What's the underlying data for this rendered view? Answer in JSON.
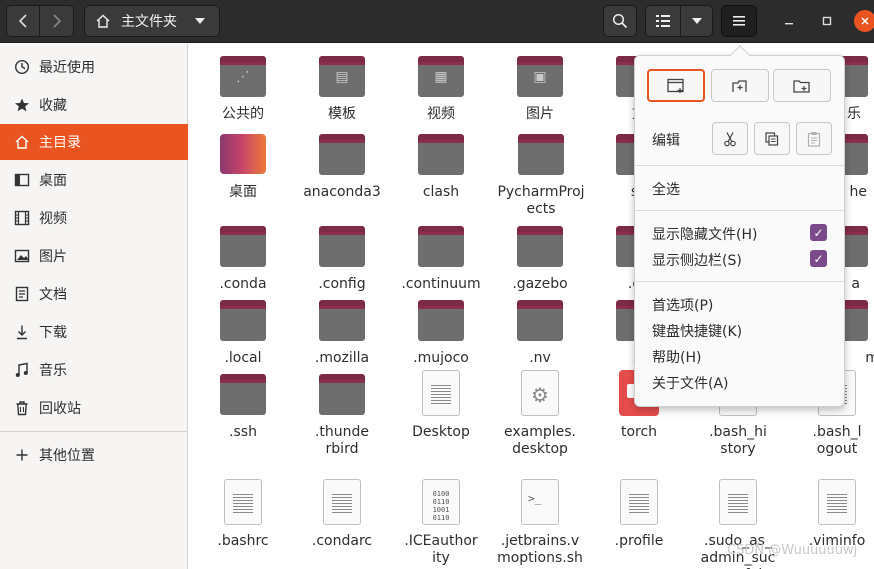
{
  "header": {
    "path_label": "主文件夹",
    "back_icon": "chevron-left-icon",
    "forward_icon": "chevron-right-icon"
  },
  "sidebar": {
    "items": [
      {
        "label": "最近使用",
        "icon": "clock-icon"
      },
      {
        "label": "收藏",
        "icon": "star-icon"
      },
      {
        "label": "主目录",
        "icon": "home-icon",
        "active": true
      },
      {
        "label": "桌面",
        "icon": "desktop-icon"
      },
      {
        "label": "视频",
        "icon": "video-icon"
      },
      {
        "label": "图片",
        "icon": "image-icon"
      },
      {
        "label": "文档",
        "icon": "document-icon"
      },
      {
        "label": "下载",
        "icon": "download-icon"
      },
      {
        "label": "音乐",
        "icon": "music-icon"
      },
      {
        "label": "回收站",
        "icon": "trash-icon"
      },
      {
        "label": "其他位置",
        "icon": "plus-icon"
      }
    ]
  },
  "files": {
    "row1": [
      "公共的",
      "模板",
      "视频",
      "图片",
      "文",
      "乐"
    ],
    "row2": [
      "桌面",
      "anaconda3",
      "clash",
      "PycharmProjects",
      "sn",
      "he"
    ],
    "row3": [
      ".conda",
      ".config",
      ".continuum",
      ".gazebo",
      ".gn",
      "a"
    ],
    "row4": [
      ".local",
      ".mozilla",
      ".mujoco",
      ".nv",
      ".p",
      "mat"
    ],
    "row5": [
      ".ssh",
      ".thunderbird",
      "Desktop",
      "examples.desktop",
      "torch",
      ".bash_history",
      ".bash_logout"
    ],
    "row6": [
      ".bashrc",
      ".condarc",
      ".ICEauthority",
      ".jetbrains.vmoptions.sh",
      ".profile",
      ".sudo_as_admin_successful",
      ".viminfo"
    ]
  },
  "menu": {
    "edit_label": "编辑",
    "select_all": "全选",
    "show_hidden": "显示隐藏文件(H)",
    "show_sidebar": "显示侧边栏(S)",
    "preferences": "首选项(P)",
    "shortcuts": "键盘快捷键(K)",
    "help": "帮助(H)",
    "about": "关于文件(A)"
  },
  "watermark": "CSDN @Wuuuuuuwj",
  "colors": {
    "accent": "#e95420",
    "folder_tab": "#7d2a47",
    "folder_body": "#6e6e6e",
    "check": "#7b4a8a"
  }
}
